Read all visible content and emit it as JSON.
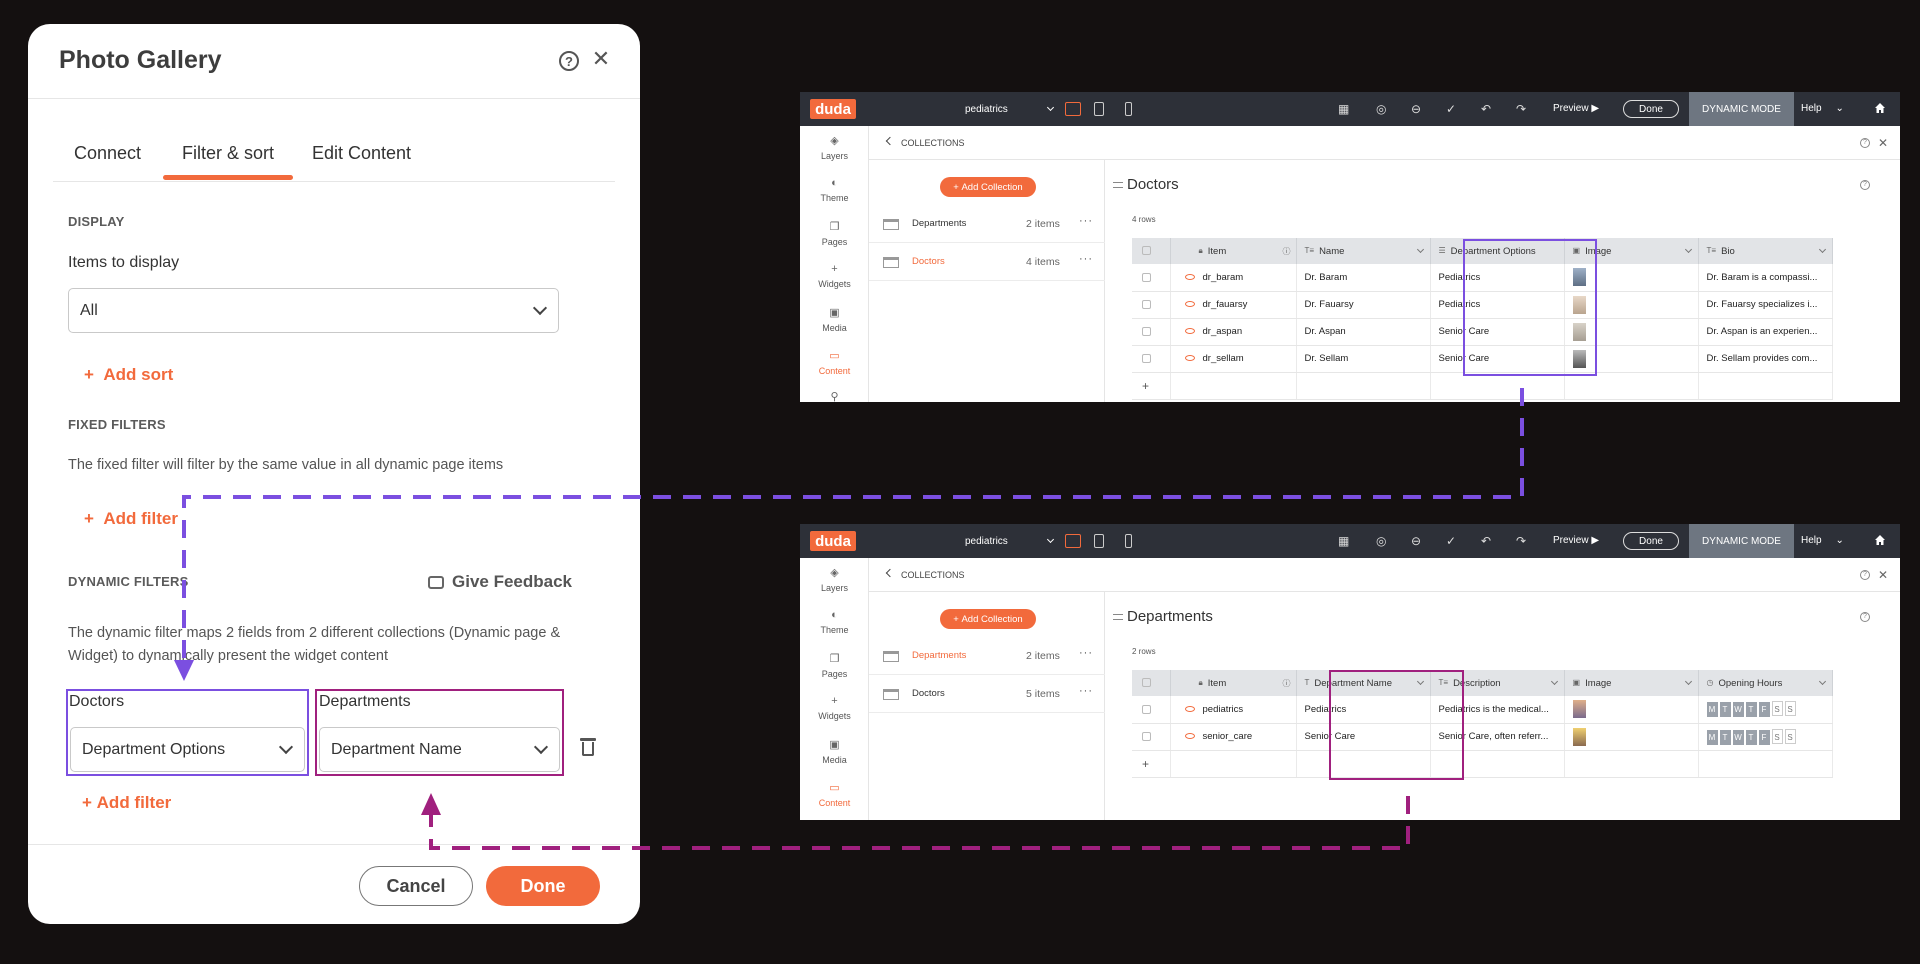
{
  "panel": {
    "title": "Photo Gallery",
    "tabs": [
      "Connect",
      "Filter & sort",
      "Edit Content"
    ],
    "display_section": "DISPLAY",
    "items_to_display_label": "Items to display",
    "items_to_display_value": "All",
    "add_sort": "Add sort",
    "fixed_filters_section": "FIXED FILTERS",
    "fixed_filters_desc": "The fixed filter will filter by the same value in all dynamic page items",
    "add_filter_fixed": "Add filter",
    "dynamic_filters_section": "DYNAMIC FILTERS",
    "give_feedback": "Give Feedback",
    "dynamic_filters_desc": "The dynamic filter maps 2 fields from 2 different collections (Dynamic page & Widget) to dynamically present the widget content",
    "left_collection": "Doctors",
    "left_field": "Department Options",
    "right_collection": "Departments",
    "right_field": "Department Name",
    "add_filter_dynamic": "Add filter",
    "cancel": "Cancel",
    "done": "Done"
  },
  "editor_common": {
    "logo": "duda",
    "site": "pediatrics",
    "preview": "Preview",
    "done": "Done",
    "dynamic_mode": "DYNAMIC MODE",
    "help": "Help",
    "breadcrumb": "COLLECTIONS",
    "add_collection": "Add Collection",
    "nav": [
      "Layers",
      "Theme",
      "Pages",
      "Widgets",
      "Media",
      "Content"
    ]
  },
  "editor_doctors": {
    "collections": [
      {
        "name": "Departments",
        "count": "2 items"
      },
      {
        "name": "Doctors",
        "count": "4 items"
      }
    ],
    "title": "Doctors",
    "rows_count": "4 rows",
    "columns": [
      "Item",
      "Name",
      "Department Options",
      "Image",
      "Bio"
    ],
    "rows": [
      {
        "item": "dr_baram",
        "name": "Dr. Baram",
        "dept": "Pediatrics",
        "bio": "Dr. Baram is a compassi..."
      },
      {
        "item": "dr_fauarsy",
        "name": "Dr. Fauarsy",
        "dept": "Pediatrics",
        "bio": "Dr. Fauarsy specializes i..."
      },
      {
        "item": "dr_aspan",
        "name": "Dr. Aspan",
        "dept": "Senior Care",
        "bio": "Dr. Aspan is an experien..."
      },
      {
        "item": "dr_sellam",
        "name": "Dr. Sellam",
        "dept": "Senior Care",
        "bio": "Dr. Sellam provides com..."
      }
    ]
  },
  "editor_departments": {
    "collections": [
      {
        "name": "Departments",
        "count": "2 items"
      },
      {
        "name": "Doctors",
        "count": "5 items"
      }
    ],
    "title": "Departments",
    "rows_count": "2 rows",
    "columns": [
      "Item",
      "Department Name",
      "Description",
      "Image",
      "Opening Hours"
    ],
    "rows": [
      {
        "item": "pediatrics",
        "dept_name": "Pediatrics",
        "desc": "Pediatrics is the medical..."
      },
      {
        "item": "senior_care",
        "dept_name": "Senior Care",
        "desc": "Senior Care, often referr..."
      }
    ],
    "days": [
      "M",
      "T",
      "W",
      "T",
      "F",
      "S",
      "S"
    ]
  },
  "colors": {
    "accent": "#f26a3c",
    "purple": "#7b4fe0",
    "magenta": "#a0207e",
    "background": "#141010"
  }
}
